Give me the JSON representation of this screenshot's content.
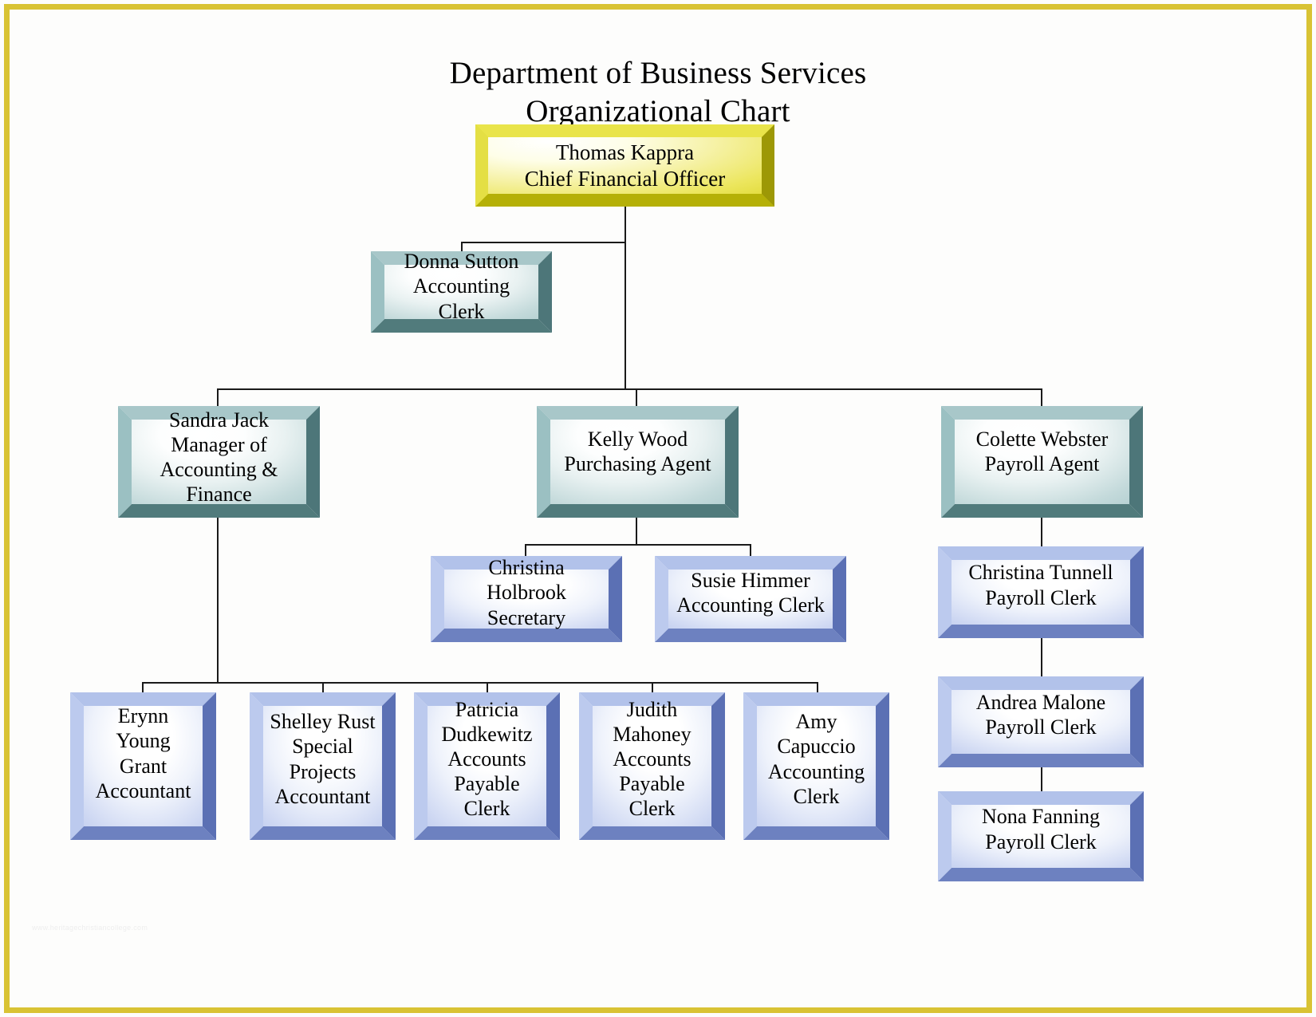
{
  "page": {
    "border_color": "#d9c334",
    "background": "#fdfdfc",
    "watermark": "www.heritagechristiancollege.com"
  },
  "title": {
    "line1": "Department of Business Services",
    "line2": "Organizational Chart"
  },
  "chart_data": {
    "type": "diagram",
    "diagram_type": "organizational-chart",
    "title": "Department of Business Services Organizational Chart",
    "levels": 4,
    "node_count": 15,
    "nodes": [
      {
        "id": "thomas-kappra",
        "name": "Thomas Kappra",
        "role": "Chief Financial Officer",
        "level": 0,
        "color": "yellow",
        "reports_to": null
      },
      {
        "id": "donna-sutton",
        "name": "Donna Sutton",
        "role": "Accounting Clerk",
        "level": 1,
        "color": "teal",
        "reports_to": "thomas-kappra",
        "assistant": true
      },
      {
        "id": "sandra-jack",
        "name": "Sandra Jack",
        "role": "Manager of\nAccounting & Finance",
        "level": 1,
        "color": "teal",
        "reports_to": "thomas-kappra"
      },
      {
        "id": "kelly-wood",
        "name": "Kelly Wood",
        "role": "Purchasing Agent",
        "level": 1,
        "color": "teal",
        "reports_to": "thomas-kappra"
      },
      {
        "id": "colette-webster",
        "name": "Colette Webster",
        "role": "Payroll Agent",
        "level": 1,
        "color": "teal",
        "reports_to": "thomas-kappra"
      },
      {
        "id": "christina-holbrook",
        "name": "Christina Holbrook",
        "role": "Secretary",
        "level": 2,
        "color": "blue",
        "reports_to": "kelly-wood"
      },
      {
        "id": "susie-himmer",
        "name": "Susie Himmer",
        "role": "Accounting Clerk",
        "level": 2,
        "color": "blue",
        "reports_to": "kelly-wood"
      },
      {
        "id": "christina-tunnell",
        "name": "Christina Tunnell",
        "role": "Payroll Clerk",
        "level": 2,
        "color": "blue",
        "reports_to": "colette-webster"
      },
      {
        "id": "andrea-malone",
        "name": "Andrea Malone",
        "role": "Payroll Clerk",
        "level": 3,
        "color": "blue",
        "reports_to": "christina-tunnell"
      },
      {
        "id": "nona-fanning",
        "name": "Nona Fanning",
        "role": "Payroll Clerk",
        "level": 4,
        "color": "blue",
        "reports_to": "andrea-malone"
      },
      {
        "id": "erynn-young",
        "name": "Erynn Young",
        "role": "Grant\nAccountant",
        "level": 2,
        "color": "blue",
        "reports_to": "sandra-jack"
      },
      {
        "id": "shelley-rust",
        "name": "Shelley Rust",
        "role": "Special\nProjects\nAccountant",
        "level": 2,
        "color": "blue",
        "reports_to": "sandra-jack"
      },
      {
        "id": "patricia-dudkewitz",
        "name": "Patricia\nDudkewitz",
        "role": "Accounts\nPayable Clerk",
        "level": 2,
        "color": "blue",
        "reports_to": "sandra-jack"
      },
      {
        "id": "judith-mahoney",
        "name": "Judith\nMahoney",
        "role": "Accounts\nPayable Clerk",
        "level": 2,
        "color": "blue",
        "reports_to": "sandra-jack"
      },
      {
        "id": "amy-capuccio",
        "name": "Amy\nCapuccio",
        "role": "Accounting\nClerk",
        "level": 2,
        "color": "blue",
        "reports_to": "sandra-jack"
      }
    ],
    "colors": {
      "yellow_box": "#d8d42b",
      "teal_box": "#a8c7c9",
      "blue_box": "#aabae6",
      "connector": "#1a1a1a",
      "page_border": "#d9c334",
      "text": "#000000"
    }
  },
  "nodes": {
    "thomas_kappra": {
      "line1": "Thomas Kappra",
      "line2": "Chief Financial Officer"
    },
    "donna_sutton": {
      "line1": "Donna Sutton",
      "line2": "Accounting Clerk"
    },
    "sandra_jack": {
      "text": "Sandra Jack\nManager of\nAccounting & Finance"
    },
    "kelly_wood": {
      "text": "Kelly Wood\nPurchasing Agent"
    },
    "colette_webster": {
      "text": "Colette Webster\nPayroll Agent"
    },
    "christina_holbrook": {
      "text": "Christina Holbrook\nSecretary"
    },
    "susie_himmer": {
      "text": "Susie Himmer\nAccounting Clerk"
    },
    "christina_tunnell": {
      "text": "Christina Tunnell\nPayroll Clerk"
    },
    "andrea_malone": {
      "text": "Andrea Malone\nPayroll Clerk"
    },
    "nona_fanning": {
      "text": "Nona Fanning\nPayroll Clerk"
    },
    "erynn_young": {
      "text": "Erynn Young\nGrant\nAccountant"
    },
    "shelley_rust": {
      "text": "Shelley Rust\nSpecial\nProjects\nAccountant"
    },
    "patricia_dudkewitz": {
      "text": "Patricia\nDudkewitz\nAccounts\nPayable Clerk"
    },
    "judith_mahoney": {
      "text": "Judith\nMahoney\nAccounts\nPayable Clerk"
    },
    "amy_capuccio": {
      "text": "Amy\nCapuccio\nAccounting\nClerk"
    }
  }
}
